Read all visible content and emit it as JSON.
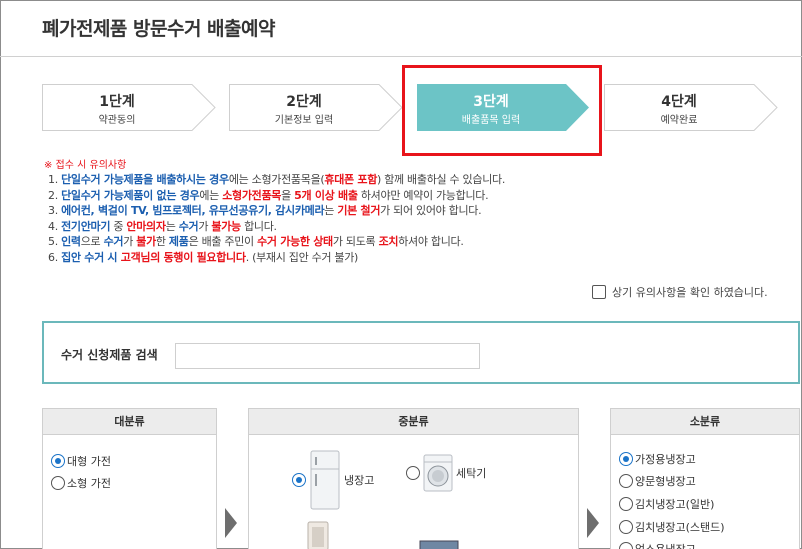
{
  "page_title": "폐가전제품 방문수거 배출예약",
  "steps": [
    {
      "label": "1단계",
      "sub": "약관동의",
      "active": false
    },
    {
      "label": "2단계",
      "sub": "기본정보 입력",
      "active": false
    },
    {
      "label": "3단계",
      "sub": "배출품목 입력",
      "active": true
    },
    {
      "label": "4단계",
      "sub": "예약완료",
      "active": false
    }
  ],
  "colors": {
    "active_step": "#6cc4c6",
    "highlight": "#e8141b",
    "accent_blue": "#1c5fb0",
    "panel_border": "#6bb8bb"
  },
  "notice": {
    "heading": "※ 접수 시 유의사항",
    "items": [
      {
        "segments": [
          {
            "t": "1. ",
            "s": ""
          },
          {
            "t": "단일수거 가능제품을 배출하시는 경우",
            "s": "b"
          },
          {
            "t": "에는 소형가전품목을(",
            "s": ""
          },
          {
            "t": "휴대폰 포함",
            "s": "r"
          },
          {
            "t": ") 함께 배출하실 수 있습니다.",
            "s": ""
          }
        ]
      },
      {
        "segments": [
          {
            "t": "2. ",
            "s": ""
          },
          {
            "t": "단일수거 가능제품이 없는 경우",
            "s": "b"
          },
          {
            "t": "에는 ",
            "s": ""
          },
          {
            "t": "소형가전품목",
            "s": "r"
          },
          {
            "t": "을 ",
            "s": ""
          },
          {
            "t": "5개 이상 배출",
            "s": "r"
          },
          {
            "t": " 하셔야만 예약이 가능합니다.",
            "s": ""
          }
        ]
      },
      {
        "segments": [
          {
            "t": "3. ",
            "s": ""
          },
          {
            "t": "에어컨, 벽걸이 TV, 빔프로젝터, 유무선공유기, 감시카메라",
            "s": "b"
          },
          {
            "t": "는 ",
            "s": ""
          },
          {
            "t": "기본 철거",
            "s": "r"
          },
          {
            "t": "가 되어 있어야 합니다.",
            "s": ""
          }
        ]
      },
      {
        "segments": [
          {
            "t": "4. ",
            "s": ""
          },
          {
            "t": "전기안마기",
            "s": "b"
          },
          {
            "t": " 중 ",
            "s": ""
          },
          {
            "t": "안마의자",
            "s": "r"
          },
          {
            "t": "는 ",
            "s": ""
          },
          {
            "t": "수거",
            "s": "b"
          },
          {
            "t": "가 ",
            "s": ""
          },
          {
            "t": "불가능",
            "s": "r"
          },
          {
            "t": " 합니다.",
            "s": ""
          }
        ]
      },
      {
        "segments": [
          {
            "t": "5. ",
            "s": ""
          },
          {
            "t": "인력",
            "s": "b"
          },
          {
            "t": "으로 ",
            "s": ""
          },
          {
            "t": "수거",
            "s": "b"
          },
          {
            "t": "가 ",
            "s": ""
          },
          {
            "t": "불가",
            "s": "r"
          },
          {
            "t": "한 ",
            "s": ""
          },
          {
            "t": "제품",
            "s": "b"
          },
          {
            "t": "은 배출 주민이 ",
            "s": ""
          },
          {
            "t": "수거 가능한 상태",
            "s": "r"
          },
          {
            "t": "가 되도록 ",
            "s": ""
          },
          {
            "t": "조치",
            "s": "r"
          },
          {
            "t": "하셔야 합니다.",
            "s": ""
          }
        ]
      },
      {
        "segments": [
          {
            "t": "6. ",
            "s": ""
          },
          {
            "t": "집안 수거 시 ",
            "s": "b"
          },
          {
            "t": "고객님의 동행이 필요합니다",
            "s": "r"
          },
          {
            "t": ". (부재시 집안 수거 불가)",
            "s": ""
          }
        ]
      }
    ]
  },
  "confirm_label": "상기 유의사항을 확인 하였습니다.",
  "search": {
    "label": "수거 신청제품 검색",
    "value": "",
    "placeholder": ""
  },
  "categories": {
    "major": {
      "title": "대분류",
      "options": [
        "대형 가전",
        "소형 가전"
      ],
      "selected": 0
    },
    "middle": {
      "title": "중분류",
      "options": [
        "냉장고",
        "세탁기"
      ],
      "selected": 0
    },
    "minor": {
      "title": "소분류",
      "options": [
        "가정용냉장고",
        "양문형냉장고",
        "김치냉장고(일반)",
        "김치냉장고(스탠드)",
        "업소용냉장고"
      ],
      "selected": 0
    }
  }
}
